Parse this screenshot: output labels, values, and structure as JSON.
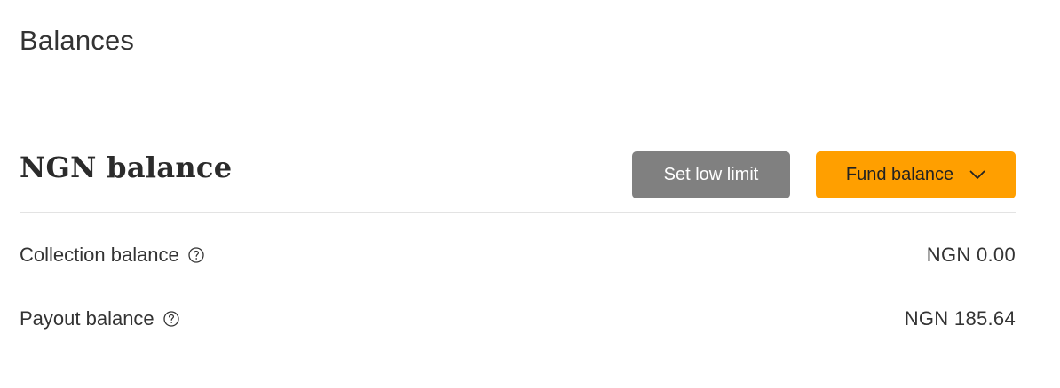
{
  "page": {
    "title": "Balances"
  },
  "balance_section": {
    "title": "NGN balance",
    "set_low_limit_label": "Set low limit",
    "fund_balance_label": "Fund balance"
  },
  "rows": [
    {
      "label": "Collection balance",
      "value": "NGN 0.00",
      "icon": "help-circle-icon"
    },
    {
      "label": "Payout balance",
      "value": "NGN 185.64",
      "icon": "help-circle-icon"
    }
  ],
  "colors": {
    "accent": "#ff9f00",
    "secondary_button": "#808080",
    "divider": "#e3e3e3",
    "text": "#333333"
  }
}
